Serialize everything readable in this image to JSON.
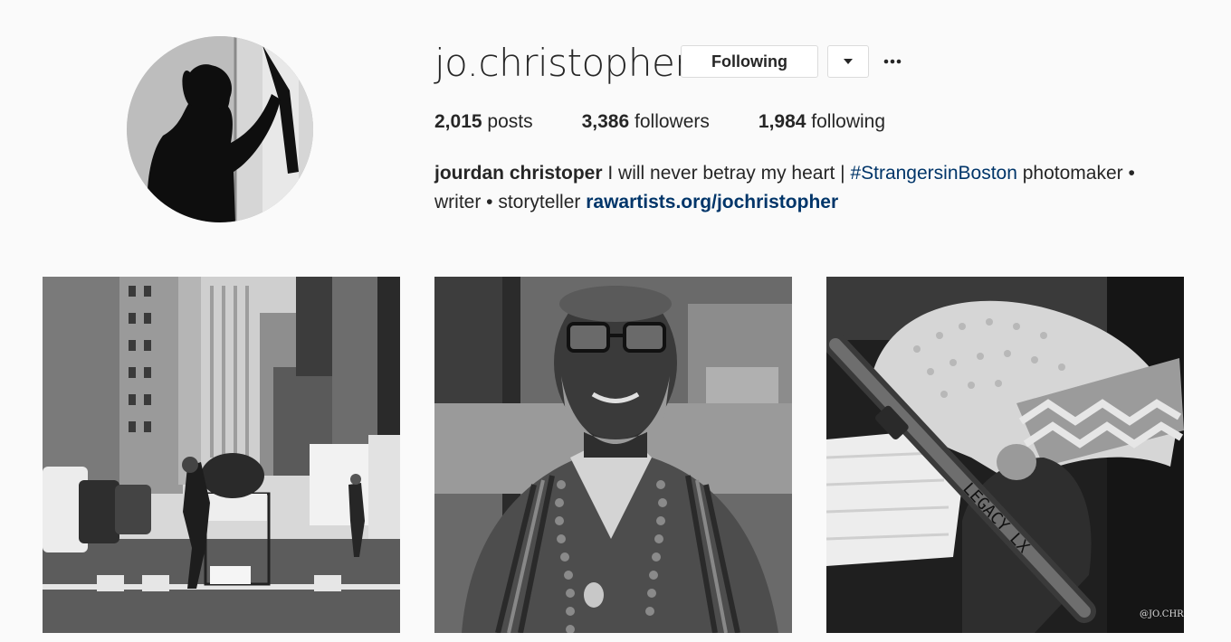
{
  "profile": {
    "username": "jo.christopher",
    "following_button_label": "Following",
    "dropdown_icon": "caret-down-icon",
    "more_icon": "ellipsis-icon"
  },
  "stats": {
    "posts_count": "2,015",
    "posts_label": "posts",
    "followers_count": "3,386",
    "followers_label": "followers",
    "following_count": "1,984",
    "following_label": "following"
  },
  "bio": {
    "full_name": "jourdan christoper",
    "text_1": "I will never betray my heart |",
    "hashtag": "#StrangersinBoston",
    "text_2": "photomaker • writer • storyteller",
    "link": "rawartists.org/jochristopher"
  },
  "posts": [
    {
      "photo": "city-street-shopping-cart-photo"
    },
    {
      "photo": "smiling-man-portrait-photo"
    },
    {
      "photo": "baby-stroller-photo",
      "watermark": "@JO.CHR",
      "stroller_text": "LEGACY LX"
    }
  ],
  "colors": {
    "background": "#fafafa",
    "text": "#262626",
    "link": "#003569",
    "border": "#dbdbdb"
  }
}
